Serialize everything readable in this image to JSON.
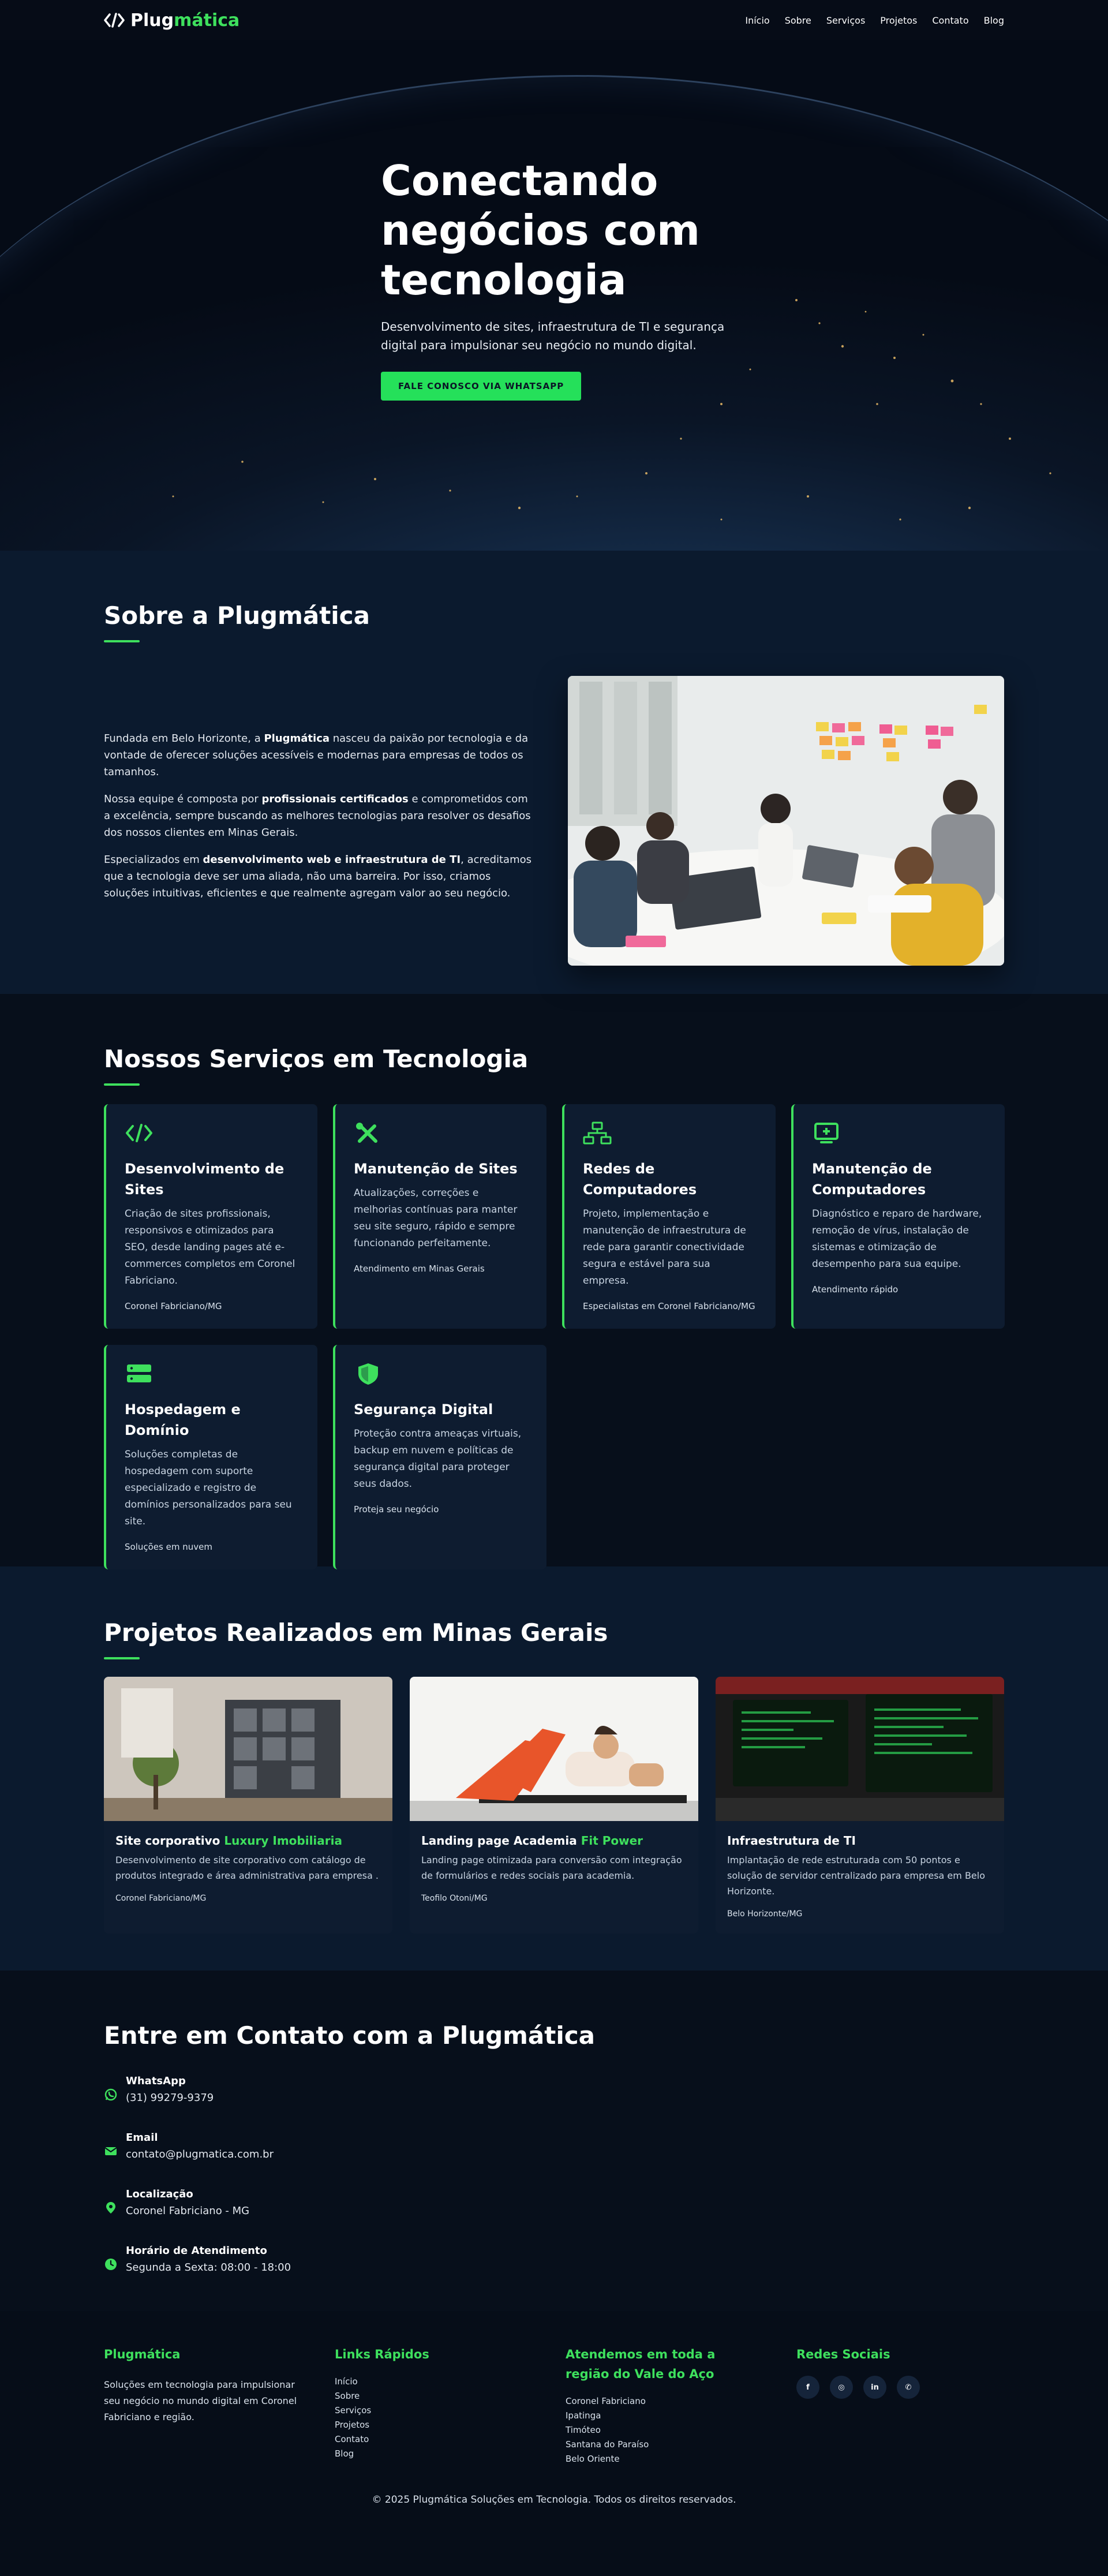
{
  "nav": {
    "brand_a": "Plug",
    "brand_b": "mática",
    "items": [
      "Início",
      "Sobre",
      "Serviços",
      "Projetos",
      "Contato",
      "Blog"
    ]
  },
  "hero": {
    "title": "Conectando negócios com tecnologia",
    "subtitle": "Desenvolvimento de sites, infraestrutura de TI e segurança digital para impulsionar seu negócio no mundo digital.",
    "cta": "FALE CONOSCO VIA WHATSAPP"
  },
  "about": {
    "title": "Sobre a Plugmática",
    "p1_a": "Fundada em Belo Horizonte, a ",
    "p1_b": "Plugmática",
    "p1_c": " nasceu da paixão por tecnologia e da vontade de oferecer soluções acessíveis e modernas para empresas de todos os tamanhos.",
    "p2_a": "Nossa equipe é composta por ",
    "p2_b": "profissionais certificados",
    "p2_c": " e comprometidos com a excelência, sempre buscando as melhores tecnologias para resolver os desafios dos nossos clientes em Minas Gerais.",
    "p3_a": "Especializados em ",
    "p3_b": "desenvolvimento web e infraestrutura de TI",
    "p3_c": ", acreditamos que a tecnologia deve ser uma aliada, não uma barreira. Por isso, criamos soluções intuitivas, eficientes e que realmente agregam valor ao seu negócio."
  },
  "services": {
    "title": "Nossos Serviços em Tecnologia",
    "items": [
      {
        "icon": "code-icon",
        "title": "Desenvolvimento de Sites",
        "text": "Criação de sites profissionais, responsivos e otimizados para SEO, desde landing pages até e-commerces completos em Coronel Fabriciano.",
        "tag": "Coronel Fabriciano/MG"
      },
      {
        "icon": "tools-icon",
        "title": "Manutenção de Sites",
        "text": "Atualizações, correções e melhorias contínuas para manter seu site seguro, rápido e sempre funcionando perfeitamente.",
        "tag": "Atendimento em Minas Gerais"
      },
      {
        "icon": "network-icon",
        "title": "Redes de Computadores",
        "text": "Projeto, implementação e manutenção de infraestrutura de rede para garantir conectividade segura e estável para sua empresa.",
        "tag": "Especialistas em Coronel Fabriciano/MG"
      },
      {
        "icon": "computer-repair-icon",
        "title": "Manutenção de Computadores",
        "text": "Diagnóstico e reparo de hardware, remoção de vírus, instalação de sistemas e otimização de desempenho para sua equipe.",
        "tag": "Atendimento rápido"
      },
      {
        "icon": "server-icon",
        "title": "Hospedagem e Domínio",
        "text": "Soluções completas de hospedagem com suporte especializado e registro de domínios personalizados para seu site.",
        "tag": "Soluções em nuvem"
      },
      {
        "icon": "shield-icon",
        "title": "Segurança Digital",
        "text": "Proteção contra ameaças virtuais, backup em nuvem e políticas de segurança digital para proteger seus dados.",
        "tag": "Proteja seu negócio"
      }
    ]
  },
  "projects": {
    "title": "Projetos Realizados em Minas Gerais",
    "items": [
      {
        "title_a": "Site corporativo ",
        "title_b": "Luxury Imobiliaria",
        "text": "Desenvolvimento de site corporativo com catálogo de produtos integrado e área administrativa para empresa .",
        "tag": "Coronel Fabriciano/MG"
      },
      {
        "title_a": "Landing page Academia ",
        "title_b": "Fit Power",
        "text": "Landing page otimizada para conversão com integração de formulários e redes sociais para academia.",
        "tag": "Teofilo Otoni/MG"
      },
      {
        "title_a": "Infraestrutura de TI",
        "title_b": "",
        "text": "Implantação de rede estruturada com 50 pontos e solução de servidor centralizado para empresa em Belo Horizonte.",
        "tag": "Belo Horizonte/MG"
      }
    ]
  },
  "contact": {
    "title": "Entre em Contato com a Plugmática",
    "items": [
      {
        "icon": "whatsapp-icon",
        "label": "WhatsApp",
        "value": "(31) 99279-9379"
      },
      {
        "icon": "email-icon",
        "label": "Email",
        "value": "contato@plugmatica.com.br"
      },
      {
        "icon": "location-icon",
        "label": "Localização",
        "value": "Coronel Fabriciano - MG"
      },
      {
        "icon": "clock-icon",
        "label": "Horário de Atendimento",
        "value": "Segunda a Sexta: 08:00 - 18:00"
      }
    ]
  },
  "footer": {
    "col1_title": "Plugmática",
    "col1_text": "Soluções em tecnologia para impulsionar seu negócio no mundo digital em Coronel Fabriciano e região.",
    "col2_title": "Links Rápidos",
    "links": [
      "Início",
      "Sobre",
      "Serviços",
      "Projetos",
      "Contato",
      "Blog"
    ],
    "col3_title": "Atendemos em toda a região do Vale do Aço",
    "cities": [
      "Coronel Fabriciano",
      "Ipatinga",
      "Timóteo",
      "Santana do Paraíso",
      "Belo Oriente"
    ],
    "col4_title": "Redes Sociais",
    "socials": [
      "f",
      "◎",
      "in",
      "✆"
    ],
    "copyright": "© 2025 Plugmática Soluções em Tecnologia. Todos os direitos reservados."
  },
  "colors": {
    "accent": "#3ee05d",
    "bg": "#0b1a2e",
    "bg_dark": "#070f1b",
    "card": "#0e1c30"
  }
}
